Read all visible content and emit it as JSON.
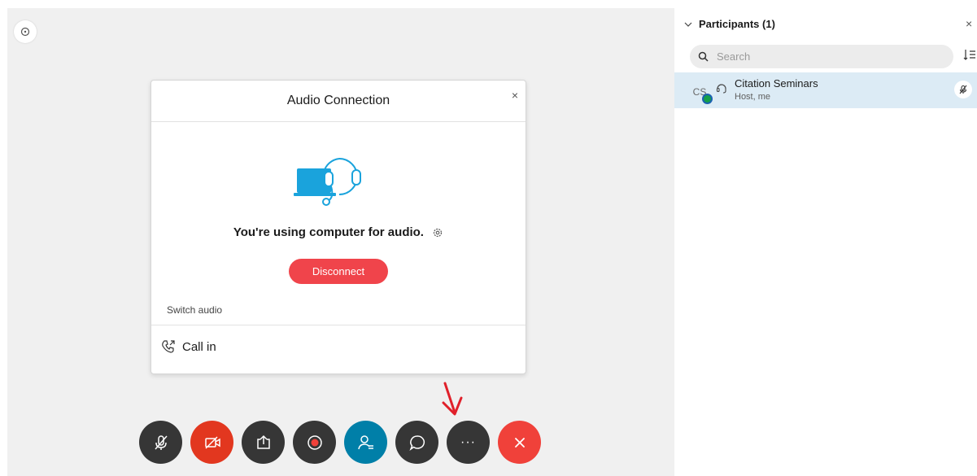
{
  "stage": {
    "corner_icon": "info-circle-icon"
  },
  "audio_dialog": {
    "title": "Audio Connection",
    "close_label": "×",
    "status_text": "You're using computer for audio.",
    "disconnect_label": "Disconnect",
    "switch_audio_label": "Switch audio",
    "call_in_label": "Call in"
  },
  "toolbar": {
    "buttons": [
      {
        "name": "mute-button",
        "icon": "mic-off-icon"
      },
      {
        "name": "start-video-button",
        "icon": "video-off-icon"
      },
      {
        "name": "share-button",
        "icon": "share-icon"
      },
      {
        "name": "record-button",
        "icon": "record-icon"
      },
      {
        "name": "participants-button",
        "icon": "participants-icon"
      },
      {
        "name": "chat-button",
        "icon": "chat-icon"
      },
      {
        "name": "more-button",
        "icon": "more-icon",
        "label": "···"
      },
      {
        "name": "end-meeting-button",
        "icon": "close-icon"
      }
    ]
  },
  "participants_panel": {
    "title": "Participants (1)",
    "close_label": "×",
    "search_placeholder": "Search",
    "participants": [
      {
        "initials": "CS",
        "name": "Citation Seminars",
        "role": "Host, me"
      }
    ]
  },
  "colors": {
    "disconnect": "#f0444b",
    "video_off": "#e2371f",
    "participants_active": "#007fa8",
    "end_meeting": "#f0413a",
    "row_highlight": "#dcebf5",
    "annotation_arrow": "#e0202a"
  }
}
